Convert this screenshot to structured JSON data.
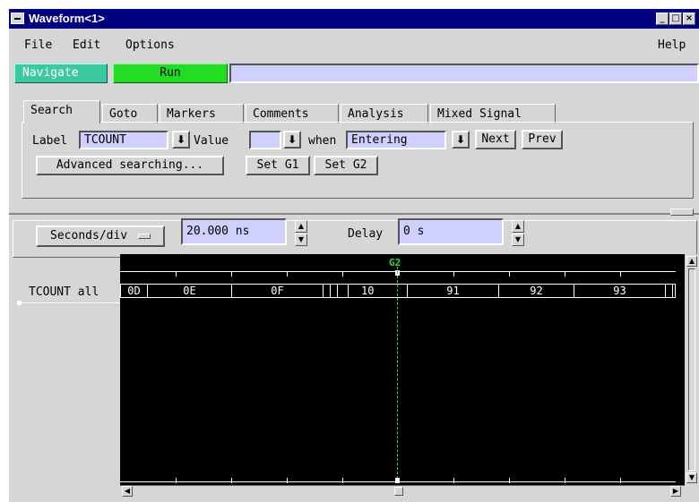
{
  "window": {
    "title": "Waveform<1>"
  },
  "menu": {
    "file": "File",
    "edit": "Edit",
    "options": "Options",
    "help": "Help"
  },
  "toolbar": {
    "navigate": "Navigate",
    "run": "Run"
  },
  "tabs": [
    "Search",
    "Goto",
    "Markers",
    "Comments",
    "Analysis",
    "Mixed Signal"
  ],
  "search": {
    "label_text": "Label",
    "label_value": "TCOUNT",
    "value_text": "Value",
    "value_value": "",
    "when_text": "when",
    "when_value": "Entering",
    "next": "Next",
    "prev": "Prev",
    "advanced": "Advanced searching...",
    "set_g1": "Set G1",
    "set_g2": "Set G2"
  },
  "timebase": {
    "seconds_div_label": "Seconds/div",
    "seconds_div_value": "20.000 ns",
    "delay_label": "Delay",
    "delay_value": "0 s"
  },
  "waveform": {
    "marker": "G2",
    "marker_color": "#33dd33",
    "signal_label": "TCOUNT all",
    "values": [
      "0D",
      "0E",
      "0F",
      "10",
      "91",
      "92",
      "93"
    ]
  },
  "colors": {
    "titlebar": "#000080",
    "navigate": "#3cc9a0",
    "run": "#22dd22",
    "field": "#d0d0ff"
  }
}
